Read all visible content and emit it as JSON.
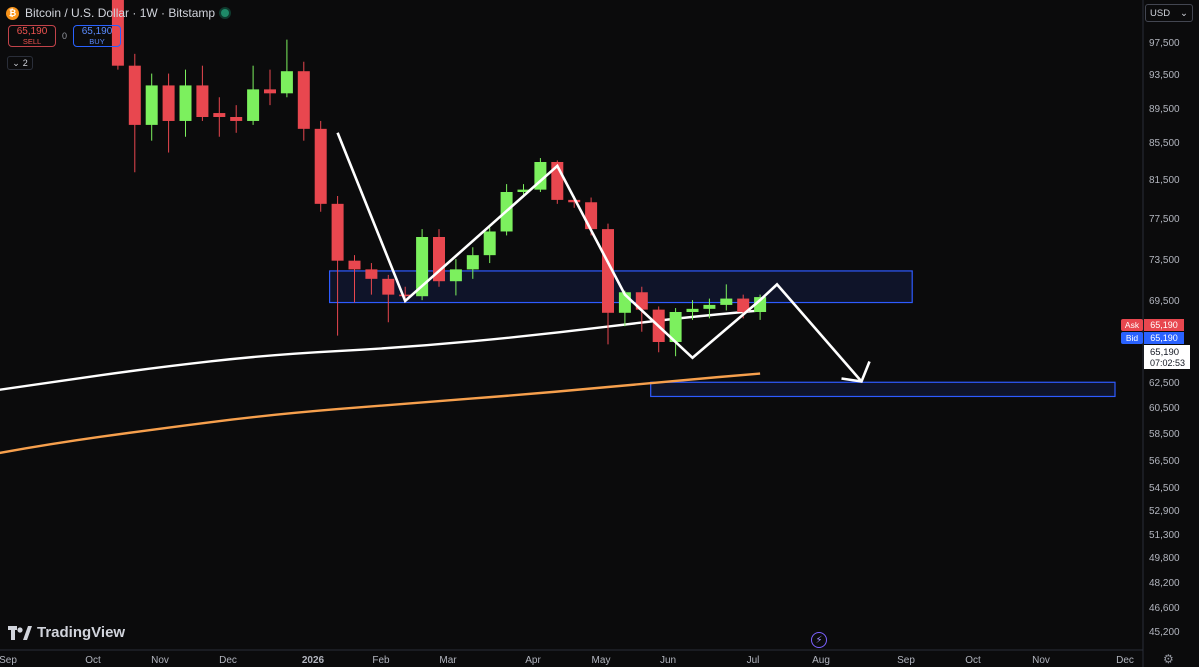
{
  "header": {
    "symbol": "Bitcoin / U.S. Dollar · 1W · Bitstamp",
    "icon": "bitcoin-icon",
    "status": "live-dot-icon"
  },
  "trade": {
    "sell_price": "65,190",
    "sell_label": "SELL",
    "spread": "0",
    "buy_price": "65,190",
    "buy_label": "BUY"
  },
  "indicators_count": "2",
  "currency": "USD",
  "brand": "TradingView",
  "colors": {
    "up": "#7CF05E",
    "down": "#E8474F",
    "ma_slow": "#F7A04D",
    "ma_fast": "#FFFFFF",
    "zone": "#2E5BFF",
    "background": "#0B0B0C"
  },
  "chart_data": {
    "type": "candlestick",
    "interval": "1W",
    "yaxis": {
      "ticks": [
        45200,
        46600,
        48200,
        49800,
        51300,
        52900,
        54500,
        56500,
        58500,
        60500,
        62500,
        65190,
        69500,
        73500,
        77500,
        81500,
        85500,
        89500,
        93500,
        97500
      ],
      "tick_labels": [
        "45,200",
        "46,600",
        "48,200",
        "49,800",
        "51,300",
        "52,900",
        "54,500",
        "56,500",
        "58,500",
        "60,500",
        "62,500",
        "65,190",
        "69,500",
        "73,500",
        "77,500",
        "81,500",
        "85,500",
        "89,500",
        "93,500",
        "97,500"
      ],
      "ylim": [
        44500,
        100500
      ]
    },
    "xaxis": {
      "labels": [
        "Sep",
        "Oct",
        "Nov",
        "Dec",
        "2026",
        "Feb",
        "Mar",
        "Apr",
        "May",
        "Jun",
        "Jul",
        "Aug",
        "Sep",
        "Oct",
        "Nov",
        "Dec"
      ]
    },
    "candles": [
      {
        "date": "2025-11-03",
        "open": 107000,
        "high": 108000,
        "low": 94000,
        "close": 94500
      },
      {
        "date": "2025-11-10",
        "open": 94500,
        "high": 96000,
        "low": 81000,
        "close": 87000
      },
      {
        "date": "2025-11-17",
        "open": 87000,
        "high": 93500,
        "low": 85000,
        "close": 92000
      },
      {
        "date": "2025-11-24",
        "open": 92000,
        "high": 93500,
        "low": 83500,
        "close": 87500
      },
      {
        "date": "2025-12-01",
        "open": 87500,
        "high": 94000,
        "low": 85500,
        "close": 92000
      },
      {
        "date": "2025-12-08",
        "open": 92000,
        "high": 94500,
        "low": 87500,
        "close": 88000
      },
      {
        "date": "2025-12-15",
        "open": 88500,
        "high": 90500,
        "low": 85500,
        "close": 88000
      },
      {
        "date": "2025-12-22",
        "open": 88000,
        "high": 89500,
        "low": 86000,
        "close": 87500
      },
      {
        "date": "2025-12-29",
        "open": 87500,
        "high": 94500,
        "low": 87000,
        "close": 91500
      },
      {
        "date": "2026-01-05",
        "open": 91500,
        "high": 94000,
        "low": 89500,
        "close": 91000
      },
      {
        "date": "2026-01-12",
        "open": 91000,
        "high": 97800,
        "low": 90500,
        "close": 93800
      },
      {
        "date": "2026-01-19",
        "open": 93800,
        "high": 95000,
        "low": 85000,
        "close": 86500
      },
      {
        "date": "2026-01-26",
        "open": 86500,
        "high": 87500,
        "low": 76000,
        "close": 77000
      },
      {
        "date": "2026-02-02",
        "open": 77000,
        "high": 78000,
        "low": 60300,
        "close": 69800
      },
      {
        "date": "2026-02-09",
        "open": 69800,
        "high": 70500,
        "low": 64500,
        "close": 68700
      },
      {
        "date": "2026-02-16",
        "open": 68700,
        "high": 69500,
        "low": 65500,
        "close": 67500
      },
      {
        "date": "2026-02-23",
        "open": 67500,
        "high": 68000,
        "low": 62000,
        "close": 65500
      },
      {
        "date": "2026-03-02",
        "open": 65500,
        "high": 66500,
        "low": 64500,
        "close": 65300
      },
      {
        "date": "2026-03-09",
        "open": 65300,
        "high": 73800,
        "low": 64800,
        "close": 72800
      },
      {
        "date": "2026-03-16",
        "open": 72800,
        "high": 73800,
        "low": 66500,
        "close": 67200
      },
      {
        "date": "2026-03-23",
        "open": 67200,
        "high": 70000,
        "low": 65400,
        "close": 68700
      },
      {
        "date": "2026-03-30",
        "open": 68700,
        "high": 71500,
        "low": 67500,
        "close": 70500
      },
      {
        "date": "2026-04-06",
        "open": 70500,
        "high": 74000,
        "low": 69500,
        "close": 73500
      },
      {
        "date": "2026-04-13",
        "open": 73500,
        "high": 79500,
        "low": 73000,
        "close": 78500
      },
      {
        "date": "2026-04-20",
        "open": 78500,
        "high": 79500,
        "low": 77800,
        "close": 78800
      },
      {
        "date": "2026-04-27",
        "open": 78800,
        "high": 82800,
        "low": 78500,
        "close": 82300
      },
      {
        "date": "2026-05-04",
        "open": 82300,
        "high": 82500,
        "low": 77000,
        "close": 77500
      },
      {
        "date": "2026-05-11",
        "open": 77500,
        "high": 78000,
        "low": 76500,
        "close": 77200
      },
      {
        "date": "2026-05-18",
        "open": 77200,
        "high": 77800,
        "low": 73000,
        "close": 73800
      },
      {
        "date": "2026-05-25",
        "open": 73800,
        "high": 74500,
        "low": 59200,
        "close": 63200
      },
      {
        "date": "2026-06-01",
        "open": 63200,
        "high": 66000,
        "low": 61500,
        "close": 65800
      },
      {
        "date": "2026-06-08",
        "open": 65800,
        "high": 66500,
        "low": 60800,
        "close": 63600
      },
      {
        "date": "2026-06-15",
        "open": 63600,
        "high": 64000,
        "low": 58200,
        "close": 59500
      },
      {
        "date": "2026-06-22",
        "open": 59500,
        "high": 63800,
        "low": 57700,
        "close": 63300
      },
      {
        "date": "2026-06-29",
        "open": 63300,
        "high": 64800,
        "low": 62300,
        "close": 63700
      },
      {
        "date": "2026-07-06",
        "open": 63700,
        "high": 65000,
        "low": 62500,
        "close": 64200
      },
      {
        "date": "2026-07-13",
        "open": 64200,
        "high": 66800,
        "low": 63500,
        "close": 65000
      },
      {
        "date": "2026-07-20",
        "open": 65000,
        "high": 65500,
        "low": 62500,
        "close": 63300
      },
      {
        "date": "2026-07-27",
        "open": 63300,
        "high": 65500,
        "low": 62300,
        "close": 65190
      }
    ],
    "moving_averages": [
      {
        "color": "#FFFFFF",
        "points": [
          [
            "2025-08-25",
            52500
          ],
          [
            "2025-10-06",
            54400
          ],
          [
            "2025-11-17",
            56200
          ],
          [
            "2026-01-05",
            57900
          ],
          [
            "2026-03-02",
            58800
          ],
          [
            "2026-04-27",
            60400
          ],
          [
            "2026-06-22",
            62500
          ],
          [
            "2026-07-27",
            63500
          ]
        ]
      },
      {
        "color": "#F7A04D",
        "points": [
          [
            "2025-08-25",
            44300
          ],
          [
            "2025-10-06",
            46600
          ],
          [
            "2025-11-17",
            48400
          ],
          [
            "2026-01-05",
            50300
          ],
          [
            "2026-03-02",
            51700
          ],
          [
            "2026-04-27",
            53000
          ],
          [
            "2026-06-22",
            54600
          ],
          [
            "2026-07-27",
            55500
          ]
        ]
      }
    ],
    "zones": [
      {
        "from": "2026-02-02",
        "to": "2026-09-28",
        "low": 64500,
        "high": 68500
      },
      {
        "from": "2026-06-15",
        "to": "2026-12-21",
        "low": 52600,
        "high": 54400
      }
    ],
    "projection": [
      [
        "2026-02-02",
        86000
      ],
      [
        "2026-03-02",
        64700
      ],
      [
        "2026-05-04",
        81800
      ],
      [
        "2026-06-01",
        65500
      ],
      [
        "2026-06-29",
        57500
      ],
      [
        "2026-07-27",
        64800
      ],
      [
        "2026-08-03",
        66800
      ],
      [
        "2026-09-07",
        54500
      ]
    ],
    "price_tags": {
      "ask_label": "Ask",
      "ask": "65,190",
      "bid_label": "Bid",
      "bid": "65,190",
      "last": "65,190",
      "countdown": "07:02:53"
    }
  }
}
